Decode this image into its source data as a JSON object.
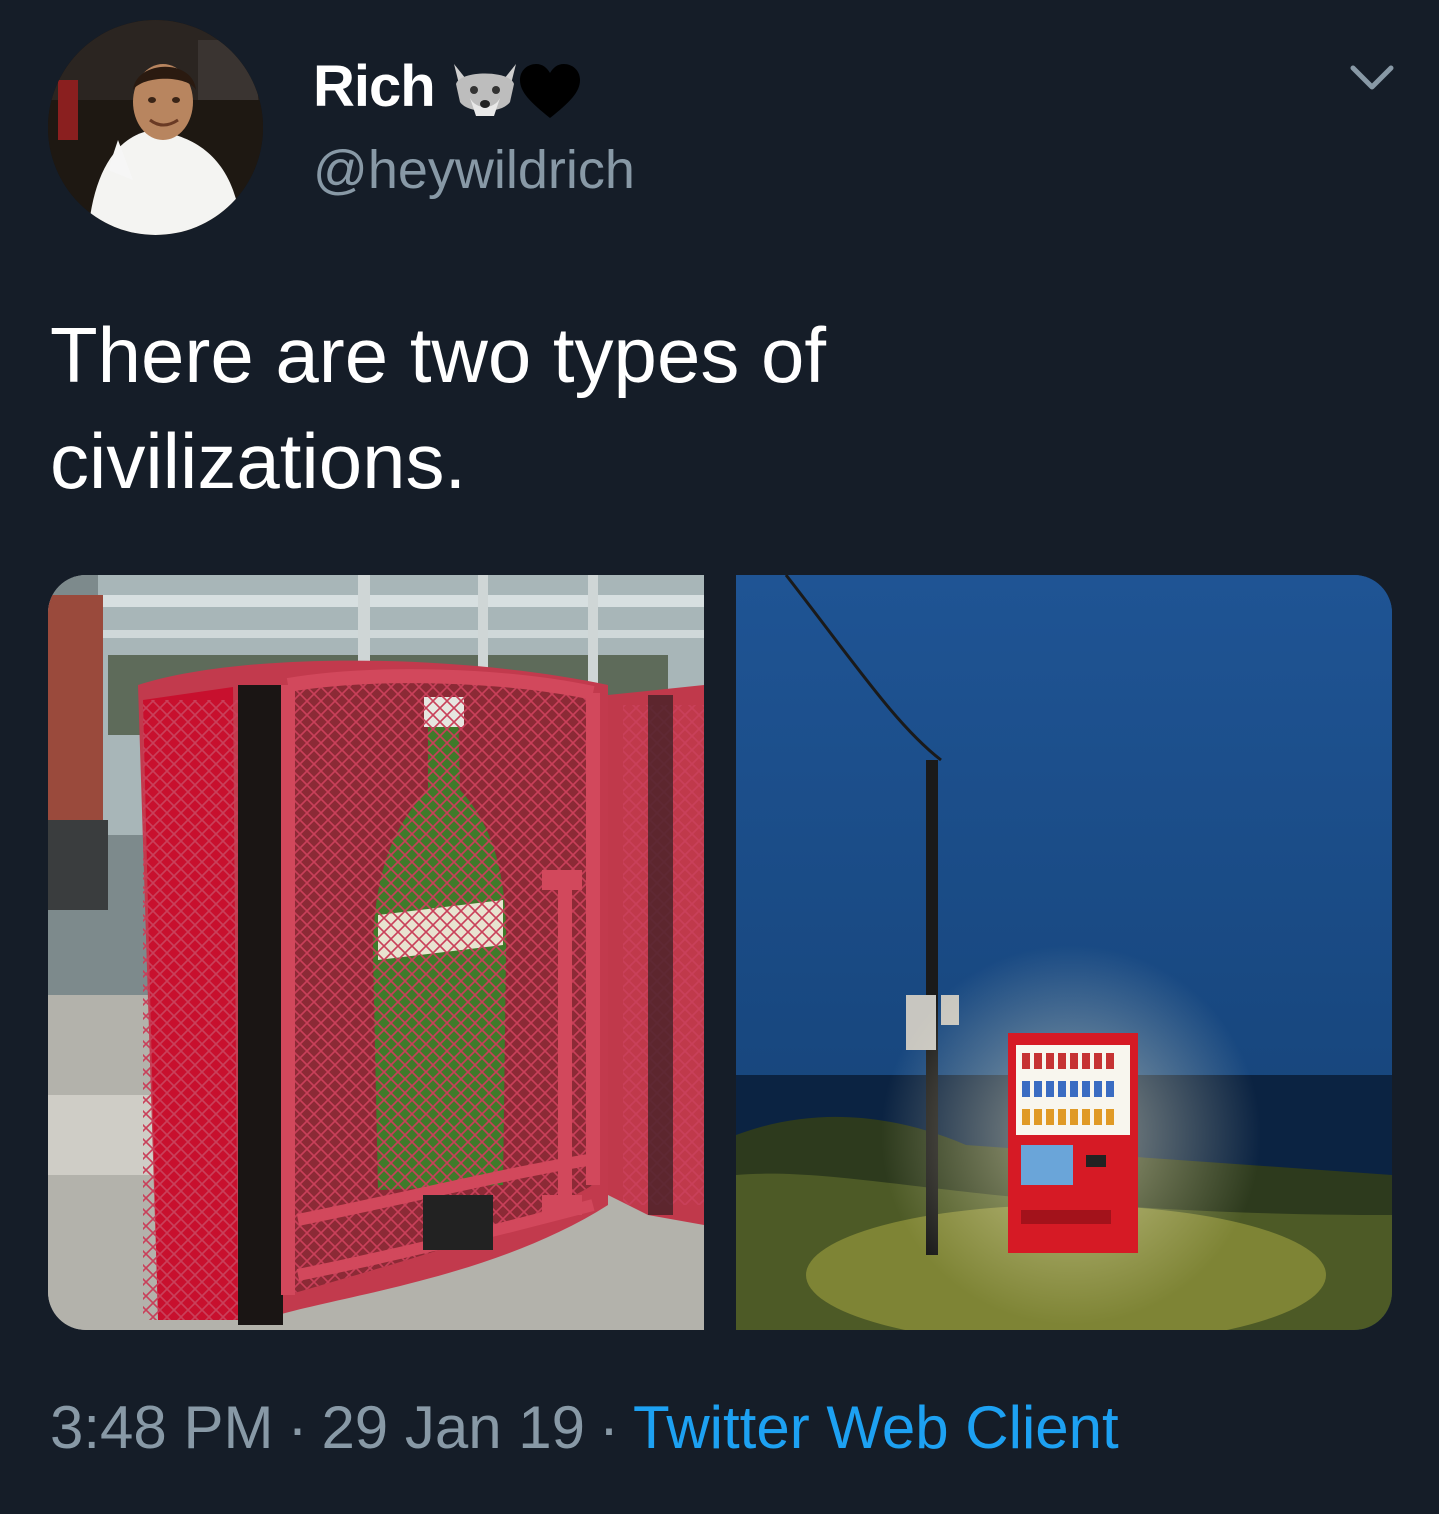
{
  "tweet": {
    "author": {
      "display_name": "Rich",
      "name_emoji": [
        "wolf-face-icon",
        "black-heart-icon"
      ],
      "handle": "@heywildrich"
    },
    "text_line1": "There are two types of",
    "text_line2": "civilizations.",
    "media": [
      {
        "description_icon": "caged-vending-machine-photo"
      },
      {
        "description_icon": "seaside-vending-machine-photo"
      }
    ],
    "time": "3:48 PM",
    "separator": "·",
    "date": "29 Jan 19",
    "source": "Twitter Web Client"
  },
  "colors": {
    "background": "#151d28",
    "text_primary": "#ffffff",
    "text_secondary": "#8899a6",
    "link": "#1da1f2"
  }
}
